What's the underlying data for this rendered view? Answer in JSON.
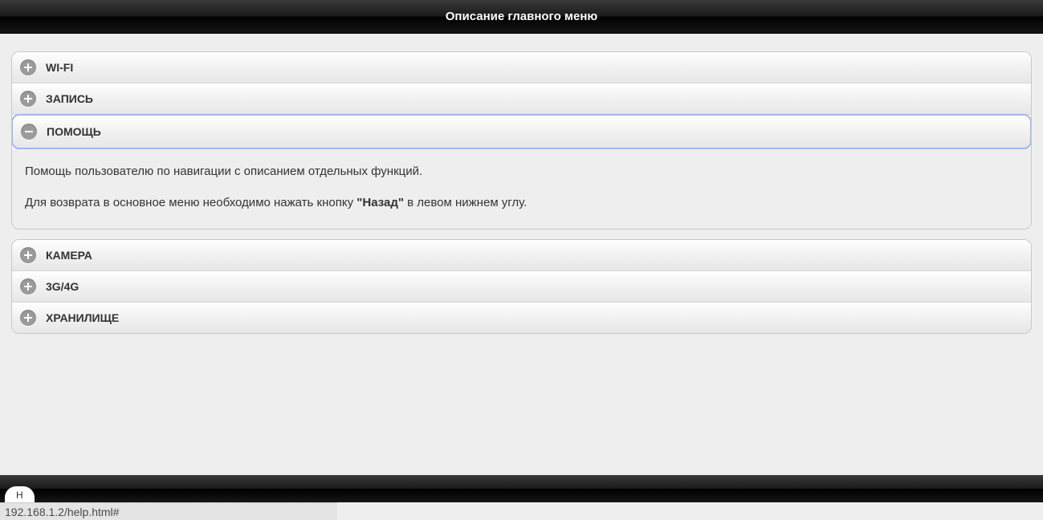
{
  "header": {
    "title": "Описание главного меню"
  },
  "accordion": {
    "group1": [
      {
        "id": "wifi",
        "label": "WI-FI",
        "expanded": false
      },
      {
        "id": "record",
        "label": "ЗАПИСЬ",
        "expanded": false
      },
      {
        "id": "help",
        "label": "ПОМОЩЬ",
        "expanded": true
      }
    ],
    "help_body": {
      "line1": "Помощь пользователю по навигации с описанием отдельных функций.",
      "line2_a": "Для возврата в основное меню необходимо нажать кнопку ",
      "line2_bold": "\"Назад\"",
      "line2_b": " в левом нижнем углу."
    },
    "group2": [
      {
        "id": "camera",
        "label": "КАМЕРА",
        "expanded": false
      },
      {
        "id": "3g4g",
        "label": "3G/4G",
        "expanded": false
      },
      {
        "id": "storage",
        "label": "ХРАНИЛИЩЕ",
        "expanded": false
      }
    ]
  },
  "footer": {
    "tab_text": "Н"
  },
  "status": {
    "url": "192.168.1.2/help.html#"
  }
}
